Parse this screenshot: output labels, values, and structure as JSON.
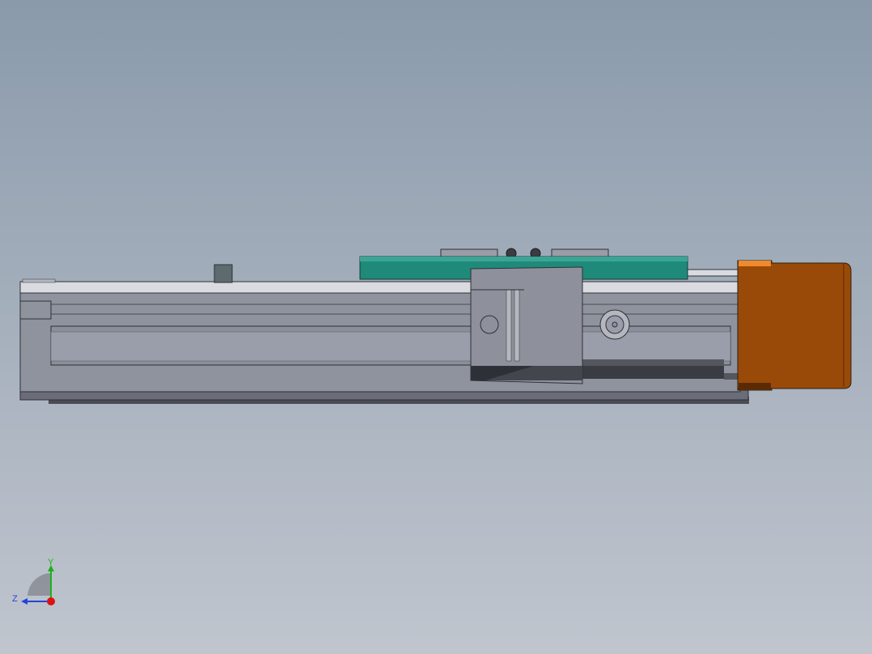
{
  "viewport": {
    "background_top": "#8a9aab",
    "background_bottom": "#c0c5ce"
  },
  "model": {
    "parts": [
      "linear-rail-body",
      "rail-slot",
      "carriage-block",
      "mounting-plate",
      "stepper-motor",
      "end-stop",
      "base-plate"
    ],
    "colors": {
      "rail": "#8f939e",
      "rail_top": "#d9dbe0",
      "carriage": "#8e919c",
      "plate": "#1f8a7a",
      "motor": "#9a4a08",
      "motor_highlight": "#f08a2c",
      "dark_strip": "#3a3c44"
    }
  },
  "triad": {
    "y_label": "Y",
    "z_label": "Z",
    "y_color": "#1ab21a",
    "z_color": "#2244dd",
    "x_color": "#dd1111"
  }
}
